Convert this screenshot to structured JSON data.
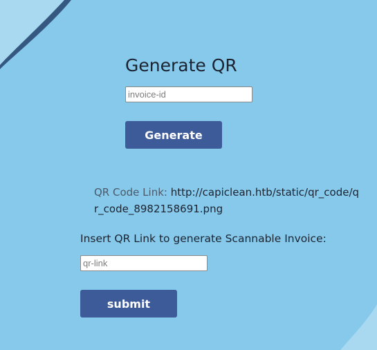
{
  "colors": {
    "background": "#87c9ea",
    "button": "#3d5a99",
    "button_text": "#ffffff",
    "text": "#1b2330",
    "label_muted": "#4a5a6a",
    "decor_light": "#a9d9f1",
    "decor_dark": "#2c4b75"
  },
  "generate_section": {
    "title": "Generate QR",
    "invoice_input": {
      "placeholder": "invoice-id",
      "value": ""
    },
    "generate_button_label": "Generate"
  },
  "result": {
    "qr_link_label": "QR Code Link:",
    "qr_link_value": "http://capiclean.htb/static/qr_code/qr_code_8982158691.png"
  },
  "insert_section": {
    "label": "Insert QR Link to generate Scannable Invoice:",
    "qr_input": {
      "placeholder": "qr-link",
      "value": ""
    },
    "submit_button_label": "submit"
  }
}
